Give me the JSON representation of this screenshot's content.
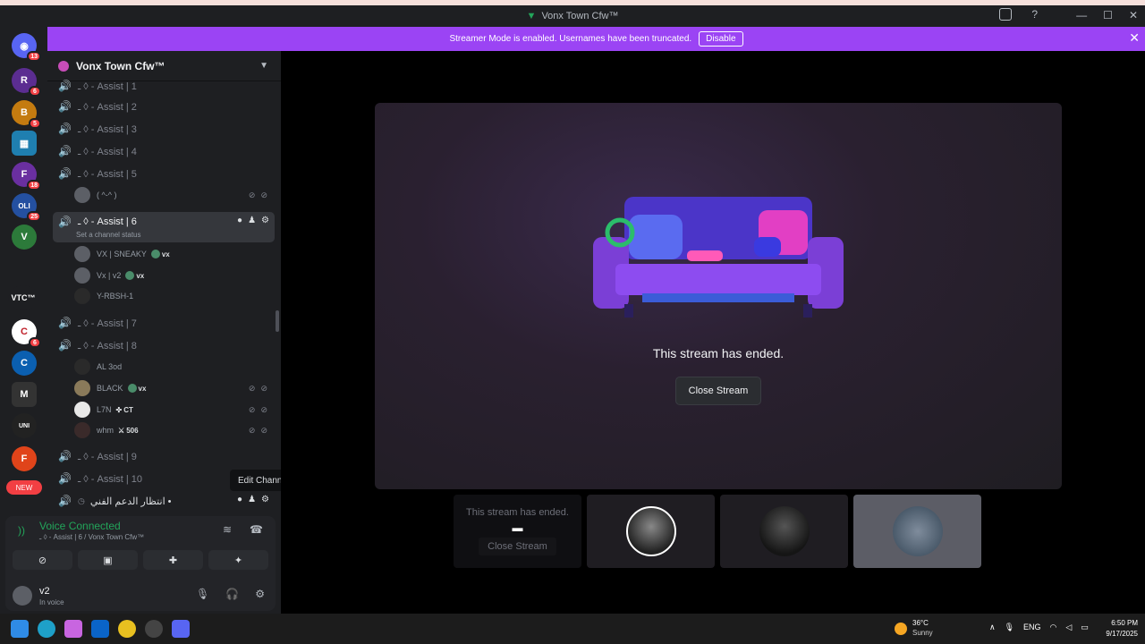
{
  "window": {
    "title": "Vonx Town Cfw™"
  },
  "banner": {
    "text": "Streamer Mode is enabled. Usernames have been truncated.",
    "disable_label": "Disable"
  },
  "guilds": {
    "items": [
      {
        "name": "home",
        "badge": "13",
        "color": "#5865f2"
      },
      {
        "name": "R",
        "badge": "6",
        "color": "#5b2d91"
      },
      {
        "name": "B",
        "badge": "5",
        "color": "#c47b10"
      },
      {
        "name": "server-blue",
        "badge": "",
        "color": "#1f7fb0"
      },
      {
        "name": "F",
        "badge": "18",
        "color": "#6a2fa0"
      },
      {
        "name": "OLI",
        "badge": "25",
        "color": "#2450a0"
      },
      {
        "name": "V",
        "badge": "",
        "color": "#2c7a3a"
      },
      {
        "name": "VTC™",
        "badge": "",
        "color": "#1e1f22"
      },
      {
        "name": "C",
        "badge": "6",
        "color": "#c0202a"
      },
      {
        "name": "C2",
        "badge": "",
        "color": "#0b5fb0"
      },
      {
        "name": "M",
        "badge": "",
        "color": "#333333"
      },
      {
        "name": "U",
        "badge": "",
        "color": "#222222"
      },
      {
        "name": "F2",
        "badge": "",
        "color": "#e0441a"
      }
    ],
    "new_label": "NEW"
  },
  "server": {
    "name": "Vonx Town Cfw™"
  },
  "channels": [
    {
      "label": "ـ ◊ - Assist | 1"
    },
    {
      "label": "ـ ◊ - Assist | 2"
    },
    {
      "label": "ـ ◊ - Assist | 3"
    },
    {
      "label": "ـ ◊ - Assist | 4"
    },
    {
      "label": "ـ ◊ - Assist | 5"
    },
    {
      "label": "ـ ◊ - Assist | 6",
      "status": "Set a channel status"
    },
    {
      "label": "ـ ◊ - Assist | 7"
    },
    {
      "label": "ـ ◊ - Assist | 8"
    },
    {
      "label": "ـ ◊ - Assist | 9"
    },
    {
      "label": "ـ ◊ - Assist | 10"
    },
    {
      "label": "انتظار الدعم الفني •"
    }
  ],
  "users": {
    "assist5": [
      {
        "name": "( ^-^ )"
      }
    ],
    "assist6": [
      {
        "name": "VX | SNEAKY",
        "tag": "vx"
      },
      {
        "name": "Vx | v2",
        "tag": "vx"
      },
      {
        "name": "Y-RBSH-1",
        "tag": ""
      }
    ],
    "assist8": [
      {
        "name": "AL 3od",
        "tag": ""
      },
      {
        "name": "BLACK",
        "tag": "vx"
      },
      {
        "name": "L7N",
        "tag": "CT"
      },
      {
        "name": "whm",
        "tag": "506"
      }
    ]
  },
  "tooltip": {
    "text": "Edit Channel"
  },
  "voice": {
    "title": "Voice Connected",
    "subtitle": "ـ ◊ - Assist | 6 / Vonx Town Cfw™"
  },
  "me": {
    "name": "v2",
    "status": "In voice"
  },
  "stream": {
    "ended_text": "This stream has ended.",
    "close_label": "Close Stream"
  },
  "thumbs": {
    "ended_text": "This stream has ended.",
    "close_label": "Close Stream"
  },
  "taskbar": {
    "weather_temp": "36°C",
    "weather_cond": "Sunny",
    "lang": "ENG",
    "time": "6:50 PM",
    "date": "9/17/2025"
  }
}
